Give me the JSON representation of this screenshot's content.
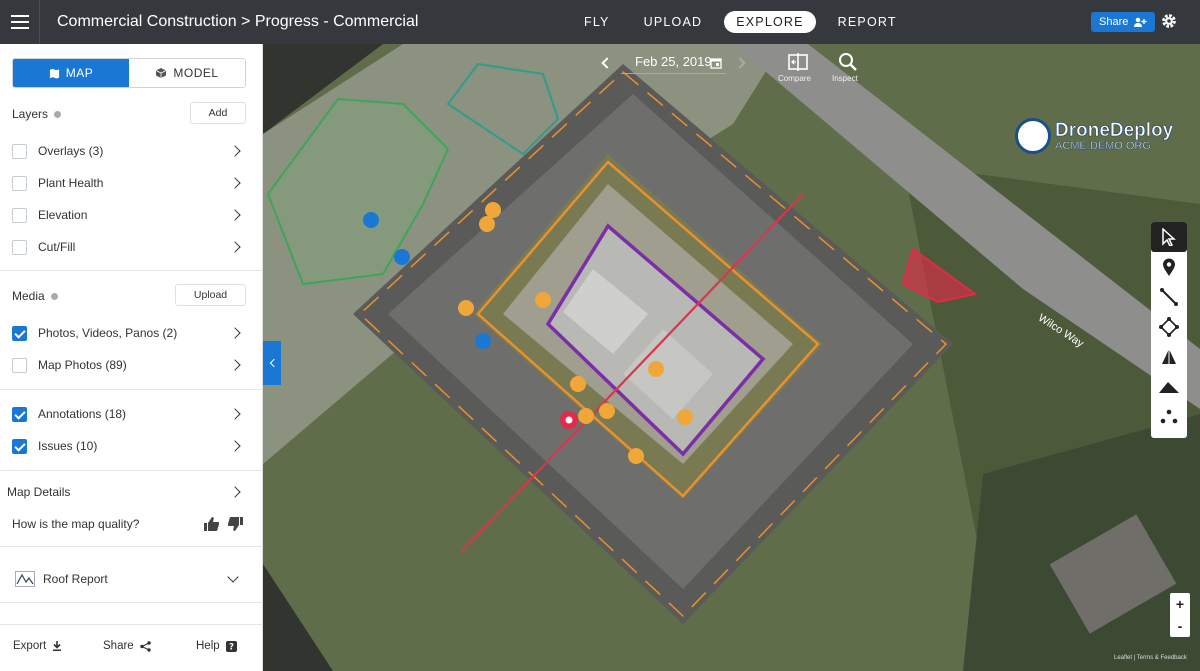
{
  "header": {
    "breadcrumb": "Commercial Construction > Progress - Commercial",
    "nav": [
      "FLY",
      "UPLOAD",
      "EXPLORE",
      "REPORT"
    ],
    "active_nav": "EXPLORE",
    "share_label": "Share"
  },
  "sidebar": {
    "view_toggle": {
      "map": "MAP",
      "model": "MODEL",
      "selected": "MAP"
    },
    "layers": {
      "title": "Layers",
      "add_label": "Add",
      "items": [
        {
          "label": "Overlays (3)",
          "checked": false
        },
        {
          "label": "Plant Health",
          "checked": false
        },
        {
          "label": "Elevation",
          "checked": false
        },
        {
          "label": "Cut/Fill",
          "checked": false
        }
      ]
    },
    "media": {
      "title": "Media",
      "upload_label": "Upload",
      "items": [
        {
          "label": "Photos, Videos, Panos (2)",
          "checked": true
        },
        {
          "label": "Map Photos (89)",
          "checked": false
        }
      ]
    },
    "annotations": [
      {
        "label": "Annotations (18)",
        "checked": true
      },
      {
        "label": "Issues (10)",
        "checked": true
      }
    ],
    "map_details": {
      "title": "Map Details",
      "quality_question": "How is the map quality?"
    },
    "roof_report": "Roof Report",
    "footer": {
      "export": "Export",
      "share": "Share",
      "help": "Help"
    }
  },
  "map": {
    "date": "Feb 25, 2019",
    "compare_label": "Compare",
    "inspect_label": "Inspect",
    "logo": {
      "brand": "DroneDeploy",
      "org": "ACME DEMO ORG"
    },
    "road_label": "Wilco Way",
    "zoom_in": "+",
    "zoom_out": "-",
    "attribution": "Leaflet | Terms & Feedback"
  },
  "colors": {
    "accent": "#1a78d4",
    "topbar": "#35393d",
    "issue_orange": "#f0a73a",
    "building_outline": "#7b2fa6",
    "measure_line": "#d6364f"
  }
}
